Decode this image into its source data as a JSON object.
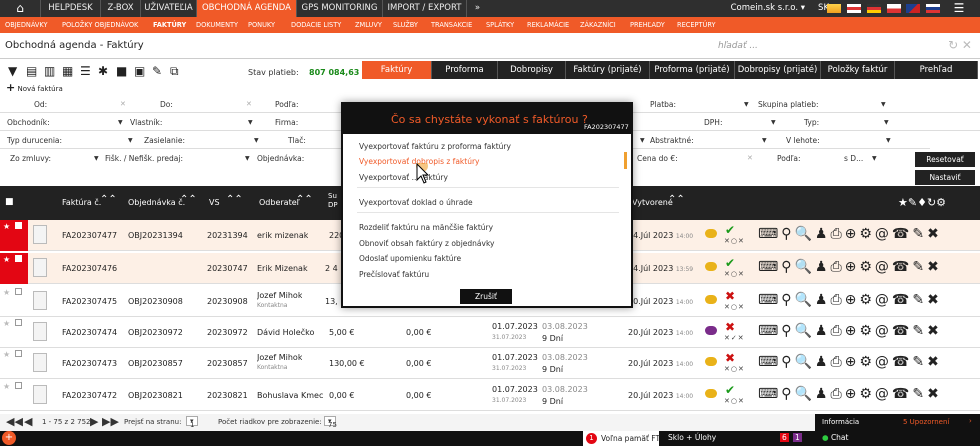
{
  "topnav": {
    "items": [
      "HELPDESK",
      "Z-BOX",
      "UŽIVATEĽIA",
      "OBCHODNÁ AGENDA",
      "GPS MONITORING",
      "IMPORT / EXPORT",
      "»"
    ],
    "company": "Comein.sk s.r.o. ▾",
    "lang": "SK ▾"
  },
  "subnav": {
    "items": [
      "OBJEDNÁVKY",
      "POLOŽKY OBJEDNÁVOK",
      "FAKTÚRY",
      "DOKUMENTY",
      "PONUKY",
      "DODACIE LISTY",
      "ZMLUVY",
      "SLUŽBY",
      "TRANSAKCIE",
      "SPLÁTKY",
      "REKLAMÁCIE",
      "ZÁKAZNÍCI",
      "PREHĽADY",
      "RECEPTÚRY"
    ]
  },
  "page": {
    "title": "Obchodná agenda - Faktúry",
    "search_placeholder": "hľadať ..."
  },
  "toolbar": {
    "new_invoice": "Nová faktúra",
    "stav_label": "Stav platieb:",
    "stav_value": "807 084,63 €"
  },
  "tabs": [
    "Faktúry",
    "Proforma",
    "Dobropisy",
    "Faktúry (prijaté)",
    "Proforma (prijaté)",
    "Dobropisy (prijaté)",
    "Položky faktúr",
    "Prehľad"
  ],
  "filters": {
    "od": "Od:",
    "do": "Do:",
    "podla": "Podľa:",
    "platba": "Platba:",
    "skupina": "Skupina platieb:",
    "obchodnik": "Obchodník:",
    "vlastnik": "Vlastník:",
    "firma": "Firma:",
    "dph": "DPH:",
    "typ": "Typ:",
    "typ_durucenia": "Typ durucenia:",
    "zasielanie": "Zasielanie:",
    "tlac": "Tlač:",
    "abstraktne": "Abstraktné:",
    "v_iehote": "V lehote:",
    "zo_zmluvy": "Zo zmluvy:",
    "fisk": "Fišk. / Nefišk. predaj:",
    "objednavka": "Objednávka:",
    "cena_do": "Cena do €:",
    "podla2": "Podľa:",
    "sd": "s D...",
    "reset": "Resetovať",
    "settings": "Nastaviť"
  },
  "table": {
    "headers": [
      "Faktúra č.",
      "Objednávka č.",
      "VS",
      "Odberateľ",
      "Su DP",
      "Vytvorené"
    ],
    "rows": [
      {
        "faktura": "FA202307477",
        "objednavka": "OBJ20231394",
        "vs": "20231394",
        "odberatel": "erik mizenak",
        "odberatel_sub": "",
        "suma": "220",
        "dph": "",
        "dat1": "",
        "dat1s": "",
        "dat2": "",
        "dat2s": "",
        "vytvorene": "24.Júl 2023",
        "vytvorene_t": "14:00",
        "status": "ok",
        "mini": "✕○✕"
      },
      {
        "faktura": "FA202307476",
        "objednavka": "",
        "vs": "20230747",
        "odberatel": "Erik Mizenak",
        "odberatel_sub": "",
        "suma": "2 4",
        "dph": "",
        "dat1": "",
        "dat1s": "",
        "dat2": "",
        "dat2s": "",
        "vytvorene": "24.Júl 2023",
        "vytvorene_t": "13:59",
        "status": "ok",
        "mini": "✕○✕"
      },
      {
        "faktura": "FA202307475",
        "objednavka": "OBJ20230908",
        "vs": "20230908",
        "odberatel": "Jozef Mihok",
        "odberatel_sub": "Kontaktna",
        "suma": "13,",
        "dph": "",
        "dat1": "",
        "dat1s": "",
        "dat2": "",
        "dat2s": "",
        "vytvorene": "20.Júl 2023",
        "vytvorene_t": "14:00",
        "status": "no",
        "mini": "✕○✕"
      },
      {
        "faktura": "FA202307474",
        "objednavka": "OBJ20230972",
        "vs": "20230972",
        "odberatel": "Dávid Holečko",
        "odberatel_sub": "",
        "suma": "5,00 €",
        "dph": "0,00 €",
        "dat1": "01.07.2023",
        "dat1s": "31.07.2023",
        "dat2": "03.08.2023",
        "dat2s": "9 Dní",
        "vytvorene": "20.Júl 2023",
        "vytvorene_t": "14:00",
        "status": "no",
        "mini": "✕✓✕"
      },
      {
        "faktura": "FA202307473",
        "objednavka": "OBJ20230857",
        "vs": "20230857",
        "odberatel": "Jozef Mihok",
        "odberatel_sub": "Kontaktna",
        "suma": "130,00 €",
        "dph": "0,00 €",
        "dat1": "01.07.2023",
        "dat1s": "31.07.2023",
        "dat2": "03.08.2023",
        "dat2s": "9 Dní",
        "vytvorene": "20.Júl 2023",
        "vytvorene_t": "14:00",
        "status": "no",
        "mini": "✕○✕"
      },
      {
        "faktura": "FA202307472",
        "objednavka": "OBJ20230821",
        "vs": "20230821",
        "odberatel": "Bohuslava Kmec",
        "odberatel_sub": "",
        "suma": "0,00 €",
        "dph": "0,00 €",
        "dat1": "01.07.2023",
        "dat1s": "31.07.2023",
        "dat2": "03.08.2023",
        "dat2s": "9 Dní",
        "vytvorene": "20.Júl 2023",
        "vytvorene_t": "14:00",
        "status": "ok",
        "mini": "✕○✕"
      }
    ]
  },
  "pager": {
    "range": "1 - 75 z 2 752",
    "per_page_label": "Prejsť na stranu:",
    "page": "1",
    "rows_label": "Počet riadkov pre zobrazenie:",
    "rows_value": "75"
  },
  "info": {
    "title": "Informácia",
    "warnings": "5 Upozornení"
  },
  "statusbar": {
    "memory_badge": "1",
    "memory": "Voľna pamäť FT",
    "sklo": "Sklo + Úlohy",
    "chat": "Chat",
    "b1": "6",
    "b2": "1"
  },
  "modal": {
    "title": "Čo sa chystáte vykonať s faktúrou ?",
    "invoice": "FA202307477",
    "options": [
      "Vyexportovať faktúru z proforma faktúry",
      "Vyexportovať dobropis z faktúry",
      "Vyexportovať ... faktúry",
      "Vyexportovať doklad o úhrade",
      "Rozdeliť faktúru na mänčšie faktúry",
      "Obnoviť obsah faktúry z objednávky",
      "Odoslať upomienku faktúre",
      "Prečíslovať faktúru"
    ],
    "close": "Zrušiť"
  },
  "colors": {
    "accent": "#f05a28",
    "dark": "#222222",
    "ok": "#1a9a1a",
    "no": "#cc1111"
  }
}
